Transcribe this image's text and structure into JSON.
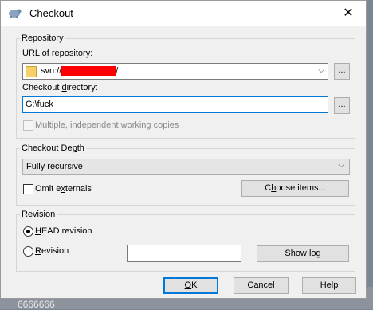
{
  "window": {
    "title": "Checkout",
    "close_glyph": "✕"
  },
  "background": {
    "text": "6666666"
  },
  "repository": {
    "legend": "Repository",
    "url_label_u": "U",
    "url_label_rest": "RL of repository:",
    "url_prefix": "svn://",
    "url_suffix": "/",
    "browse_label": "...",
    "checkout_dir_label_pre": "Checkout ",
    "checkout_dir_label_u": "d",
    "checkout_dir_label_post": "irectory:",
    "checkout_dir_value": "G:\\fuck",
    "dir_browse_label": "...",
    "multiple_wc_label": "Multiple, independent working copies",
    "multiple_wc_checked": false
  },
  "depth": {
    "legend_pre": "Checkout De",
    "legend_u": "p",
    "legend_post": "th",
    "selected": "Fully recursive",
    "omit_u": "",
    "omit_pre": "Omit e",
    "omit_u2": "x",
    "omit_post": "ternals",
    "omit_checked": false,
    "choose_pre": "C",
    "choose_u": "h",
    "choose_post": "oose items..."
  },
  "revision": {
    "legend": "Revision",
    "head_u": "H",
    "head_rest": "EAD revision",
    "head_selected": true,
    "rev_u": "R",
    "rev_rest": "evision",
    "rev_value": "",
    "showlog_pre": "Show ",
    "showlog_u": "l",
    "showlog_post": "og"
  },
  "buttons": {
    "ok_u": "O",
    "ok_rest": "K",
    "cancel": "Cancel",
    "help": "Help"
  },
  "colors": {
    "accent": "#0078d7",
    "redaction": "#ff0000"
  }
}
